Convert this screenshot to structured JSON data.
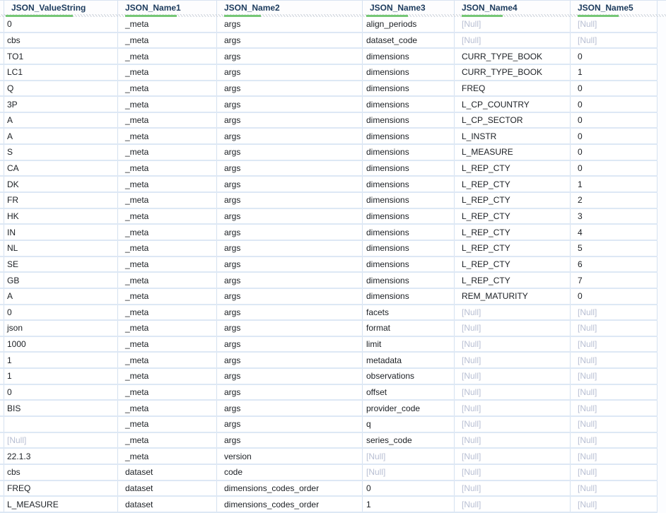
{
  "table": {
    "columns": [
      {
        "label": "JSON_ValueString"
      },
      {
        "label": "JSON_Name1"
      },
      {
        "label": "JSON_Name2"
      },
      {
        "label": "JSON_Name3"
      },
      {
        "label": "JSON_Name4"
      },
      {
        "label": "JSON_Name5"
      }
    ],
    "null_label": "[Null]",
    "rows": [
      [
        "0",
        "_meta",
        "args",
        "align_periods",
        null,
        null
      ],
      [
        "cbs",
        "_meta",
        "args",
        "dataset_code",
        null,
        null
      ],
      [
        "TO1",
        "_meta",
        "args",
        "dimensions",
        "CURR_TYPE_BOOK",
        "0"
      ],
      [
        "LC1",
        "_meta",
        "args",
        "dimensions",
        "CURR_TYPE_BOOK",
        "1"
      ],
      [
        "Q",
        "_meta",
        "args",
        "dimensions",
        "FREQ",
        "0"
      ],
      [
        "3P",
        "_meta",
        "args",
        "dimensions",
        "L_CP_COUNTRY",
        "0"
      ],
      [
        "A",
        "_meta",
        "args",
        "dimensions",
        "L_CP_SECTOR",
        "0"
      ],
      [
        "A",
        "_meta",
        "args",
        "dimensions",
        "L_INSTR",
        "0"
      ],
      [
        "S",
        "_meta",
        "args",
        "dimensions",
        "L_MEASURE",
        "0"
      ],
      [
        "CA",
        "_meta",
        "args",
        "dimensions",
        "L_REP_CTY",
        "0"
      ],
      [
        "DK",
        "_meta",
        "args",
        "dimensions",
        "L_REP_CTY",
        "1"
      ],
      [
        "FR",
        "_meta",
        "args",
        "dimensions",
        "L_REP_CTY",
        "2"
      ],
      [
        "HK",
        "_meta",
        "args",
        "dimensions",
        "L_REP_CTY",
        "3"
      ],
      [
        "IN",
        "_meta",
        "args",
        "dimensions",
        "L_REP_CTY",
        "4"
      ],
      [
        "NL",
        "_meta",
        "args",
        "dimensions",
        "L_REP_CTY",
        "5"
      ],
      [
        "SE",
        "_meta",
        "args",
        "dimensions",
        "L_REP_CTY",
        "6"
      ],
      [
        "GB",
        "_meta",
        "args",
        "dimensions",
        "L_REP_CTY",
        "7"
      ],
      [
        "A",
        "_meta",
        "args",
        "dimensions",
        "REM_MATURITY",
        "0"
      ],
      [
        "0",
        "_meta",
        "args",
        "facets",
        null,
        null
      ],
      [
        "json",
        "_meta",
        "args",
        "format",
        null,
        null
      ],
      [
        "1000",
        "_meta",
        "args",
        "limit",
        null,
        null
      ],
      [
        "1",
        "_meta",
        "args",
        "metadata",
        null,
        null
      ],
      [
        "1",
        "_meta",
        "args",
        "observations",
        null,
        null
      ],
      [
        "0",
        "_meta",
        "args",
        "offset",
        null,
        null
      ],
      [
        "BIS",
        "_meta",
        "args",
        "provider_code",
        null,
        null
      ],
      [
        "",
        "_meta",
        "args",
        "q",
        null,
        null
      ],
      [
        null,
        "_meta",
        "args",
        "series_code",
        null,
        null
      ],
      [
        "22.1.3",
        "_meta",
        "version",
        null,
        null,
        null
      ],
      [
        "cbs",
        "dataset",
        "code",
        null,
        null,
        null
      ],
      [
        "FREQ",
        "dataset",
        "dimensions_codes_order",
        "0",
        null,
        null
      ],
      [
        "L_MEASURE",
        "dataset",
        "dimensions_codes_order",
        "1",
        null,
        null
      ]
    ]
  },
  "colors": {
    "header_text": "#1b3a5c",
    "header_accent_green": "#76c776",
    "cell_text": "#1b1f24",
    "null_text": "#b8bfd3",
    "grid_line_vertical": "#d5e1f0",
    "grid_line_horizontal": "#dde8f5"
  }
}
